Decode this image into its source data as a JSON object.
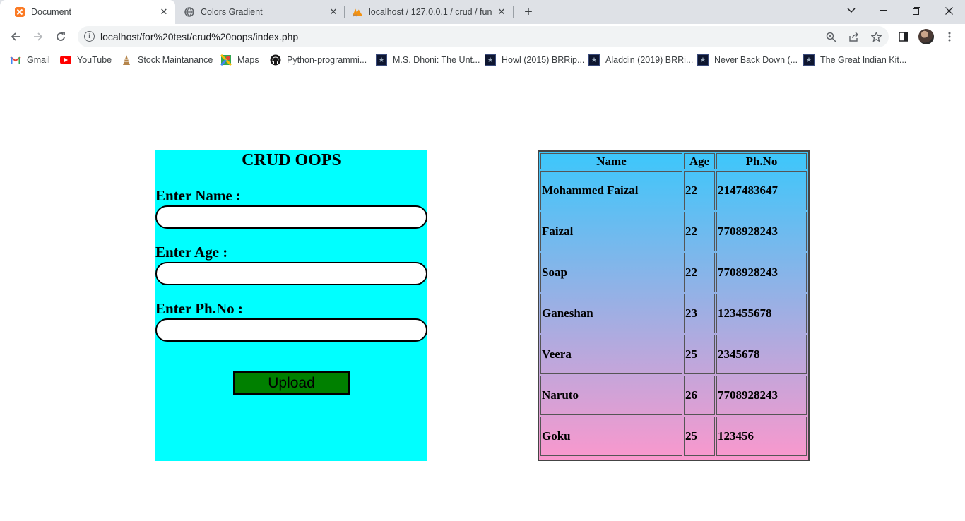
{
  "browser": {
    "tabs": [
      {
        "title": "Document",
        "active": true,
        "icon": "xampp-icon"
      },
      {
        "title": "Colors Gradient",
        "active": false,
        "icon": "globe-icon"
      },
      {
        "title": "localhost / 127.0.0.1 / crud / fun",
        "active": false,
        "icon": "phpmyadmin-icon"
      }
    ],
    "url": "localhost/for%20test/crud%20oops/index.php",
    "bookmarks": [
      {
        "label": "Gmail",
        "icon": "gmail-icon"
      },
      {
        "label": "YouTube",
        "icon": "youtube-icon"
      },
      {
        "label": "Stock Maintanance",
        "icon": "stock-icon"
      },
      {
        "label": "Maps",
        "icon": "maps-icon"
      },
      {
        "label": "Python-programmi...",
        "icon": "github-icon"
      },
      {
        "label": "M.S. Dhoni: The Unt...",
        "icon": "movie-icon"
      },
      {
        "label": "Howl (2015) BRRip...",
        "icon": "movie-icon"
      },
      {
        "label": "Aladdin (2019) BRRi...",
        "icon": "movie-icon"
      },
      {
        "label": "Never Back Down (...",
        "icon": "movie-icon"
      },
      {
        "label": "The Great Indian Kit...",
        "icon": "movie-icon"
      }
    ]
  },
  "form": {
    "title": "CRUD OOPS",
    "name_label": "Enter Name :",
    "age_label": "Enter Age :",
    "phone_label": "Enter Ph.No :",
    "name_value": "",
    "age_value": "",
    "phone_value": "",
    "upload_label": "Upload",
    "background_color": "#00ffff",
    "button_color": "#008000"
  },
  "table": {
    "headers": {
      "name": "Name",
      "age": "Age",
      "phone": "Ph.No"
    },
    "rows": [
      {
        "name": "Mohammed Faizal",
        "age": "22",
        "phone": "2147483647"
      },
      {
        "name": "Faizal",
        "age": "22",
        "phone": "7708928243"
      },
      {
        "name": "Soap",
        "age": "22",
        "phone": "7708928243"
      },
      {
        "name": "Ganeshan",
        "age": "23",
        "phone": "123455678"
      },
      {
        "name": "Veera",
        "age": "25",
        "phone": "2345678"
      },
      {
        "name": "Naruto",
        "age": "26",
        "phone": "7708928243"
      },
      {
        "name": "Goku",
        "age": "25",
        "phone": "123456"
      }
    ],
    "gradient_top": "#3cc7fb",
    "gradient_bottom": "#fa98cd"
  }
}
